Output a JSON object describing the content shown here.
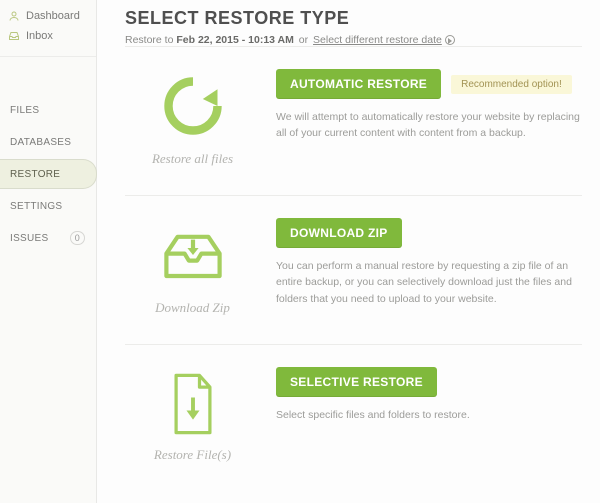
{
  "topnav": {
    "dashboard": "Dashboard",
    "inbox": "Inbox"
  },
  "sidebar": {
    "items": [
      {
        "label": "FILES"
      },
      {
        "label": "DATABASES"
      },
      {
        "label": "RESTORE"
      },
      {
        "label": "SETTINGS"
      },
      {
        "label": "ISSUES",
        "badge": "0"
      }
    ]
  },
  "header": {
    "title": "SELECT RESTORE TYPE",
    "restore_prefix": "Restore to ",
    "restore_date": "Feb 22, 2015 - 10:13 AM",
    "or": " or ",
    "select_different": "Select different restore date"
  },
  "rows": {
    "auto": {
      "caption": "Restore all files",
      "button": "AUTOMATIC RESTORE",
      "recommended": "Recommended option!",
      "desc": "We will attempt to automatically restore your website by replacing all of your current content with content from a backup."
    },
    "zip": {
      "caption": "Download Zip",
      "button": "DOWNLOAD ZIP",
      "desc": "You can perform a manual restore by requesting a zip file of an entire backup, or you can selectively download just the files and folders that you need to upload to your website."
    },
    "selective": {
      "caption": "Restore File(s)",
      "button": "SELECTIVE RESTORE",
      "desc": "Select specific files and folders to restore."
    }
  }
}
